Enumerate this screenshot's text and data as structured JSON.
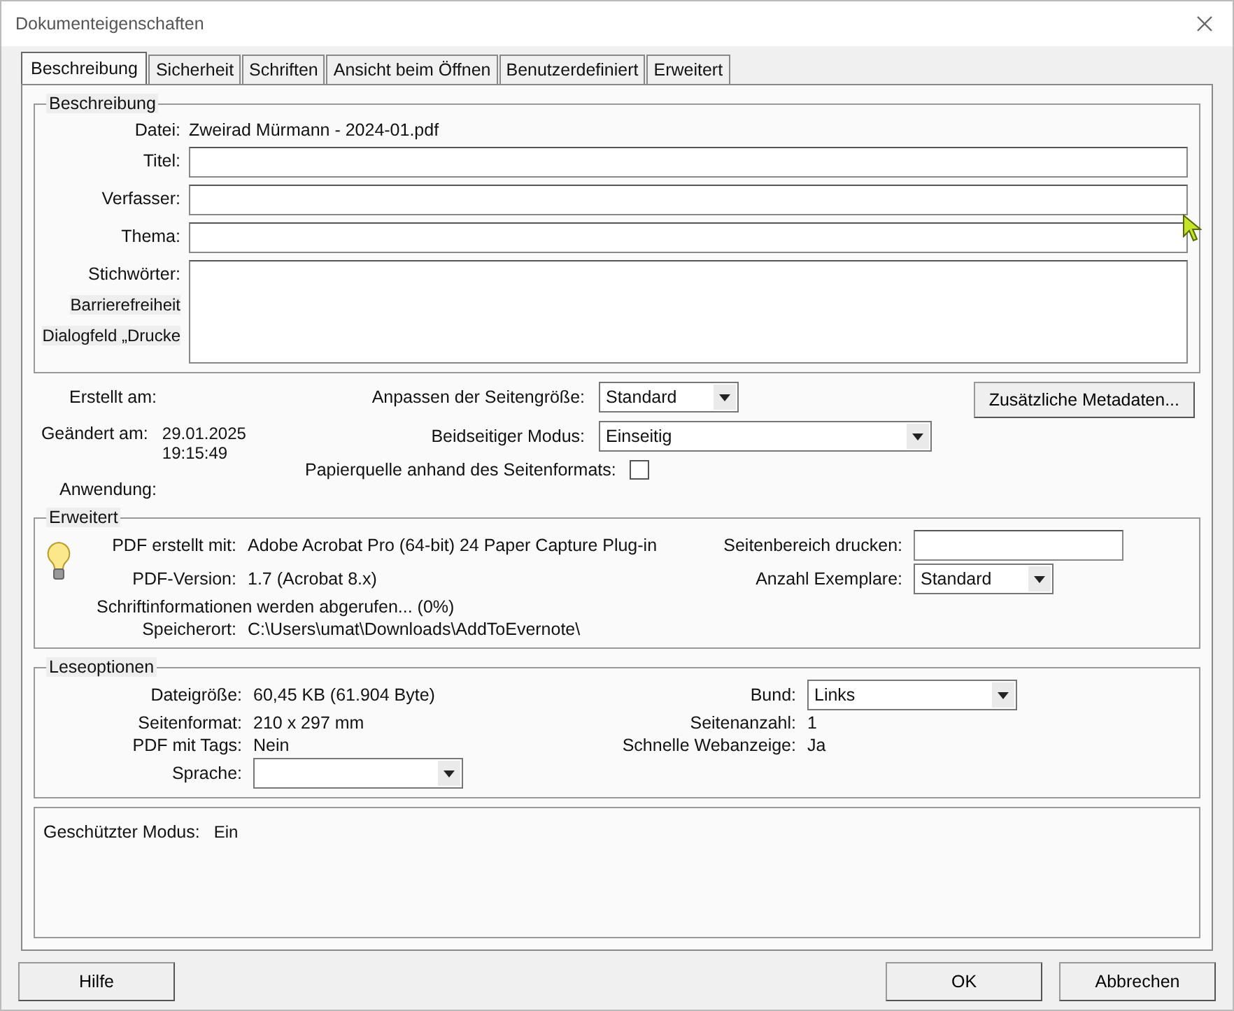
{
  "window": {
    "title": "Dokumenteigenschaften"
  },
  "tabs": [
    {
      "label": "Beschreibung",
      "selected": true
    },
    {
      "label": "Sicherheit",
      "selected": false
    },
    {
      "label": "Schriften",
      "selected": false
    },
    {
      "label": "Ansicht beim Öffnen",
      "selected": false
    },
    {
      "label": "Benutzerdefiniert",
      "selected": false
    },
    {
      "label": "Erweitert",
      "selected": false
    }
  ],
  "description": {
    "legend": "Beschreibung",
    "file_label": "Datei:",
    "file_name": "Zweirad Mürmann - 2024-01.pdf",
    "fields": [
      {
        "label": "Titel:",
        "kind": "line"
      },
      {
        "label": "Verfasser:",
        "kind": "line"
      },
      {
        "label": "Thema:",
        "kind": "line"
      },
      {
        "label": "Stichwörter:",
        "kind": "multiline"
      }
    ],
    "side_legends": [
      "Barrierefreiheit",
      "Dialogfeld „Drucke"
    ]
  },
  "dates": [
    {
      "label": "Erstellt am:"
    },
    {
      "label": "Geändert am:",
      "value": "29.01.2025 19:15:49"
    },
    {
      "label": "Anwendung:"
    }
  ],
  "print_options": [
    {
      "kind": "dropdown",
      "label": "Anpassen der Seitengröße:",
      "value": "Standard"
    },
    {
      "kind": "dropdown",
      "label": "Beidseitiger Modus:",
      "value": "Einseitig"
    },
    {
      "kind": "checkbox",
      "label": "Papierquelle anhand des Seitenformats:",
      "checked": false
    }
  ],
  "metadata_button": "Zusätzliche Metadaten...",
  "advanced": {
    "legend": "Erweitert",
    "items": [
      {
        "kind": "info",
        "label": "PDF erstellt mit:",
        "value": "Adobe Acrobat Pro (64-bit) 24 Paper Capture Plug-in"
      },
      {
        "kind": "field",
        "label": "Seitenbereich drucken:"
      },
      {
        "kind": "info",
        "label": "PDF-Version:",
        "value": "1.7 (Acrobat 8.x)"
      },
      {
        "kind": "dropdown",
        "label": "Anzahl Exemplare:",
        "value": "Standard"
      },
      {
        "kind": "note",
        "value": "Schriftinformationen werden abgerufen... (0%)"
      },
      {
        "kind": "info",
        "label": "Speicherort:",
        "value": "C:\\Users\\umat\\Downloads\\AddToEvernote\\"
      }
    ]
  },
  "reading": {
    "legend": "Leseoptionen",
    "items": [
      {
        "kind": "info",
        "label": "Dateigröße:",
        "value": "60,45 KB (61.904 Byte)"
      },
      {
        "kind": "dropdown",
        "label": "Bund:",
        "value": "Links"
      },
      {
        "kind": "info",
        "label": "Seitenformat:",
        "value": "210 x 297 mm"
      },
      {
        "kind": "info",
        "label": "Seitenanzahl:",
        "value": "1"
      },
      {
        "kind": "info",
        "label": "PDF mit Tags:",
        "value": "Nein"
      },
      {
        "kind": "info",
        "label": "Schnelle Webanzeige:",
        "value": "Ja"
      },
      {
        "kind": "dropdown",
        "label": "Sprache:"
      }
    ]
  },
  "protected_mode": {
    "label": "Geschützter Modus:",
    "value": "Ein"
  },
  "buttons": {
    "help": "Hilfe",
    "ok": "OK",
    "cancel": "Abbrechen"
  }
}
